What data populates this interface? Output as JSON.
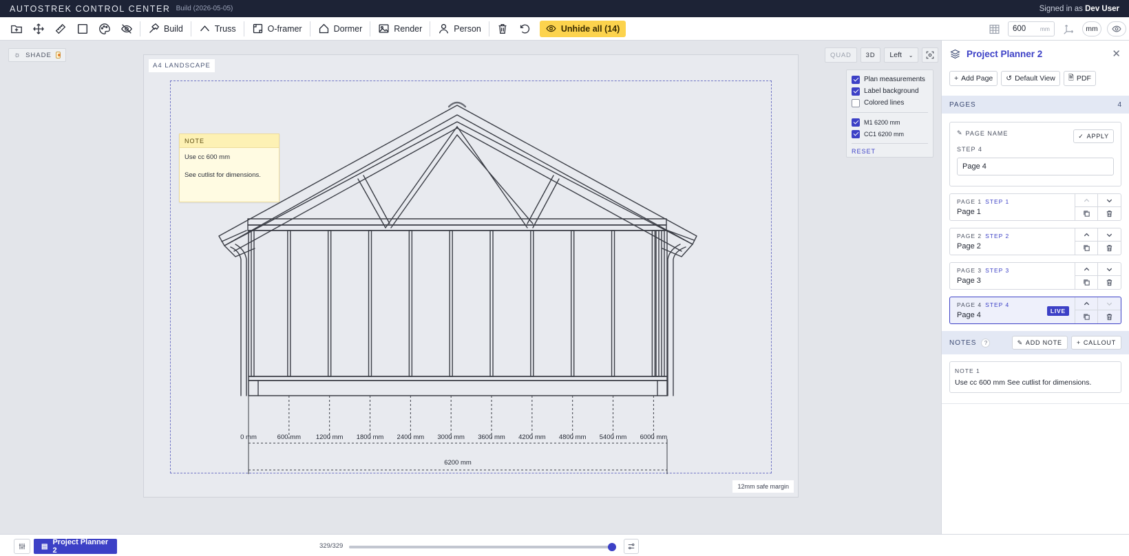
{
  "titlebar": {
    "app_title": "AUTOSTREK CONTROL CENTER",
    "build": "Build (2026-05-05)",
    "signed_in_prefix": "Signed in as",
    "user": "Dev User"
  },
  "toolbar": {
    "icons": [
      "new-folder-icon",
      "move-icon",
      "ruler-icon",
      "rectangle-icon",
      "palette-icon",
      "eye-off-icon"
    ],
    "buttons": [
      {
        "label": "Build",
        "icon": "hammer-icon"
      },
      {
        "label": "Truss",
        "icon": "truss-icon"
      },
      {
        "label": "O-framer",
        "icon": "frame-icon"
      },
      {
        "label": "Dormer",
        "icon": "dormer-icon"
      },
      {
        "label": "Render",
        "icon": "image-icon"
      },
      {
        "label": "Person",
        "icon": "person-icon"
      }
    ],
    "unhide_label": "Unhide all (14)",
    "grid_value": "600",
    "grid_unit": "mm",
    "unit_toggle": "mm"
  },
  "canvas": {
    "shade_label": "SHADE",
    "paper_label": "A4 LANDSCAPE",
    "safe_margin_label": "12mm safe margin",
    "note": {
      "header": "NOTE",
      "line1": "Use cc 600 mm",
      "line2": "See cutlist for dimensions."
    },
    "view": {
      "quad": "QUAD",
      "three_d": "3D",
      "direction": "Left"
    },
    "options": {
      "items": [
        {
          "label": "Plan measurements",
          "checked": true
        },
        {
          "label": "Label background",
          "checked": true
        },
        {
          "label": "Colored lines",
          "checked": false
        }
      ],
      "members": [
        {
          "label": "M1 6200 mm",
          "checked": true
        },
        {
          "label": "CC1 6200 mm",
          "checked": true
        }
      ],
      "reset_label": "RESET"
    },
    "dimensions": {
      "ticks": [
        "0 mm",
        "600 mm",
        "1200 mm",
        "1800 mm",
        "2400 mm",
        "3000 mm",
        "3600 mm",
        "4200 mm",
        "4800 mm",
        "5400 mm",
        "6000 mm"
      ],
      "total": "6200 mm"
    }
  },
  "panel": {
    "title": "Project Planner 2",
    "actions": {
      "add_page": "Add Page",
      "default_view": "Default View",
      "pdf": "PDF"
    },
    "pages_header": "PAGES",
    "pages_count": "4",
    "edit": {
      "label": "PAGE NAME",
      "apply": "APPLY",
      "step": "STEP 4",
      "value": "Page 4"
    },
    "pages": [
      {
        "num": "PAGE 1",
        "step": "STEP 1",
        "name": "Page 1"
      },
      {
        "num": "PAGE 2",
        "step": "STEP 2",
        "name": "Page 2"
      },
      {
        "num": "PAGE 3",
        "step": "STEP 3",
        "name": "Page 3"
      },
      {
        "num": "PAGE 4",
        "step": "STEP 4",
        "name": "Page 4",
        "badge": "LIVE"
      }
    ],
    "notes_header": "NOTES",
    "notes_help": "?",
    "add_note": "ADD NOTE",
    "callout": "CALLOUT",
    "note_items": [
      {
        "title": "NOTE 1",
        "text": "Use cc 600 mm See cutlist for dimensions."
      }
    ]
  },
  "bottombar": {
    "project_label": "Project Planner 2",
    "step_counter": "329/329",
    "progress": 1.0
  },
  "colors": {
    "accent": "#3c40c6",
    "titlebar": "#1d2336",
    "unhide": "#fcd34d"
  }
}
